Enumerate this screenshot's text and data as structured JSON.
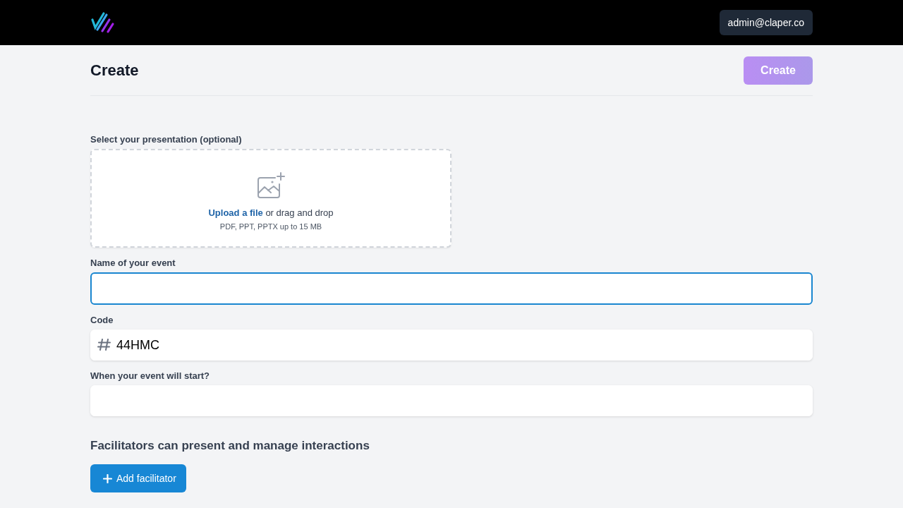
{
  "header": {
    "account_button": "admin@claper.co"
  },
  "page": {
    "title": "Create",
    "create_button": {
      "label": "Create",
      "disabled": true
    }
  },
  "presentation": {
    "label": "Select your presentation (optional)",
    "upload_link": "Upload a file",
    "upload_text": "or drag and drop",
    "hint": "PDF, PPT, PPTX up to 15 MB"
  },
  "fields": [
    {
      "kind": "text",
      "label": "Name of your event",
      "focused": true
    },
    {
      "kind": "code",
      "label": "Code",
      "value": "44HMC",
      "focused": false
    },
    {
      "kind": "text",
      "label": "When your event will start?",
      "focused": false
    }
  ],
  "facilitators": {
    "heading": "Facilitators can present and manage interactions",
    "add_button": "Add facilitator"
  }
}
